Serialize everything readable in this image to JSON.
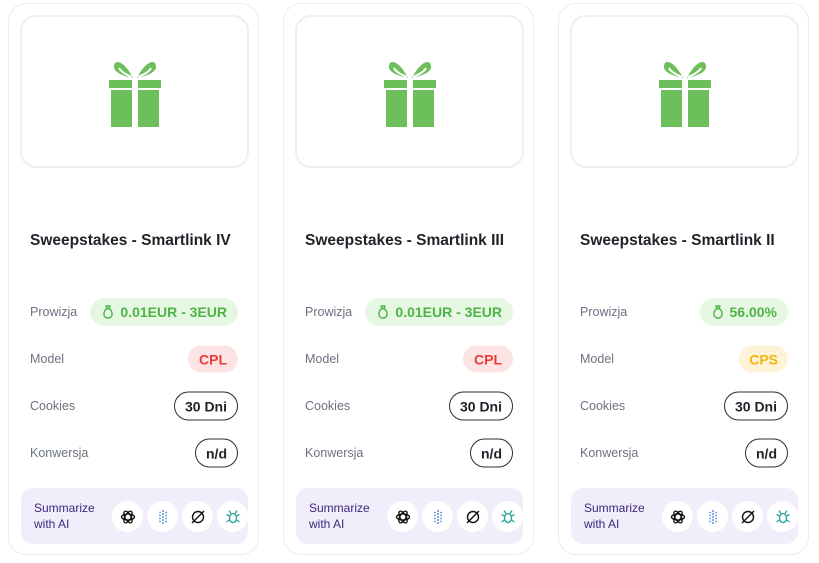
{
  "colors": {
    "gift_green": "#6cbf5b",
    "commission_green": "#4cb544",
    "cpl_red": "#ea3b3b",
    "cps_yellow": "#f2b60d",
    "ai_purple_bg": "#f1edfb"
  },
  "labels": {
    "commission": "Prowizja",
    "model": "Model",
    "cookies": "Cookies",
    "conversion": "Konwersja",
    "summarize_line1": "Summarize",
    "summarize_line2": "with AI"
  },
  "ai_icons": [
    "chatgpt-icon",
    "perplexity-icon",
    "grok-icon",
    "claude-icon"
  ],
  "offers": [
    {
      "title": "Sweepstakes - Smartlink IV",
      "commission": "0.01EUR - 3EUR",
      "model": "CPL",
      "model_color": "red",
      "cookies": "30 Dni",
      "conversion": "n/d",
      "image_icon": "gift-icon"
    },
    {
      "title": "Sweepstakes - Smartlink III",
      "commission": "0.01EUR - 3EUR",
      "model": "CPL",
      "model_color": "red",
      "cookies": "30 Dni",
      "conversion": "n/d",
      "image_icon": "gift-icon"
    },
    {
      "title": "Sweepstakes - Smartlink II",
      "commission": "56.00%",
      "model": "CPS",
      "model_color": "yellow",
      "cookies": "30 Dni",
      "conversion": "n/d",
      "image_icon": "gift-icon"
    }
  ]
}
